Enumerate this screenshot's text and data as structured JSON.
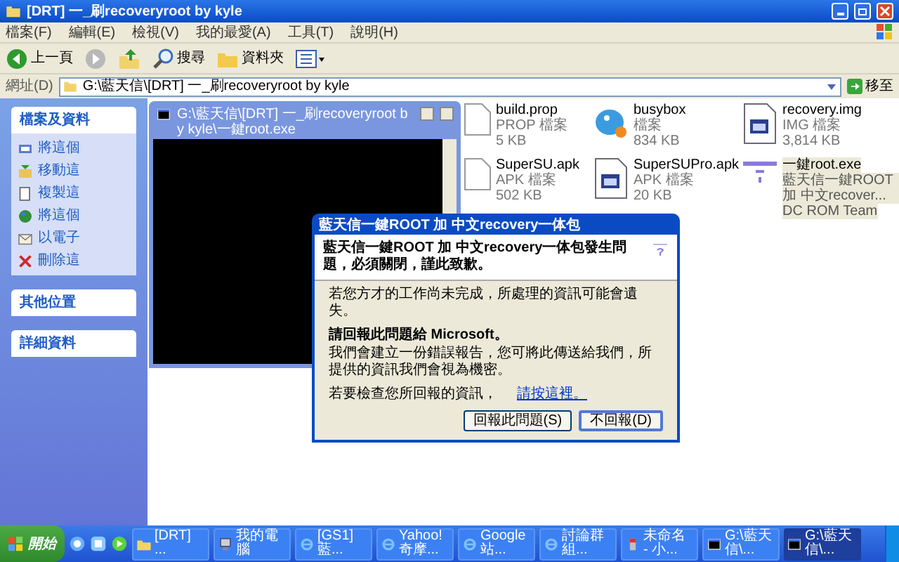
{
  "window": {
    "title": "[DRT] 一_刷recoveryroot by kyle"
  },
  "menu": [
    "檔案(F)",
    "編輯(E)",
    "檢視(V)",
    "我的最愛(A)",
    "工具(T)",
    "說明(H)"
  ],
  "toolbar": [
    {
      "kind": "back",
      "label": "上一頁"
    },
    {
      "kind": "forward"
    },
    {
      "kind": "up"
    },
    {
      "kind": "search",
      "label": "搜尋"
    },
    {
      "kind": "folders",
      "label": "資料夾"
    },
    {
      "kind": "views"
    }
  ],
  "address": {
    "label": "網址(D)",
    "value": "G:\\藍天信\\[DRT] 一_刷recoveryroot by kyle",
    "go": "移至"
  },
  "sidebar": {
    "sections": [
      {
        "title": "檔案及資料",
        "items": [
          "將這個",
          "移動這",
          "複製這",
          "將這個",
          "以電子",
          "刪除這"
        ]
      },
      {
        "title": "其他位置"
      },
      {
        "title": "詳細資料"
      }
    ]
  },
  "files": [
    {
      "kind": "doc",
      "name": "build.prop",
      "type": "PROP 檔案",
      "size": "5 KB",
      "selected": false
    },
    {
      "kind": "busybox",
      "name": "busybox",
      "type": "檔案",
      "size": "834 KB",
      "selected": false
    },
    {
      "kind": "app",
      "name": "recovery.img",
      "type": "IMG 檔案",
      "size": "3,814 KB",
      "selected": false
    },
    {
      "kind": "doc",
      "name": "SuperSU.apk",
      "type": "APK 檔案",
      "size": "502 KB",
      "selected": false
    },
    {
      "kind": "app",
      "name": "SuperSUPro.apk",
      "type": "APK 檔案",
      "size": "20 KB",
      "selected": false
    },
    {
      "kind": "exe",
      "name": "一鍵root.exe",
      "type": "藍天信一鍵ROOT 加 中文recover...",
      "size": "DC ROM Team",
      "selected": true
    }
  ],
  "console": {
    "title": "G:\\藍天信\\[DRT] 一_刷recoveryroot by kyle\\一鍵root.exe"
  },
  "dialog": {
    "title": "藍天信一鍵ROOT 加 中文recovery一体包",
    "heading": "藍天信一鍵ROOT 加 中文recovery一体包發生問題，必須關閉，謹此致歉。",
    "warning": "若您方才的工作尚未完成，所處理的資訊可能會遺失。",
    "report_title": "請回報此問題給 Microsoft。",
    "report_body": "我們會建立一份錯誤報告，您可將此傳送給我們，所提供的資訊我們會視為機密。",
    "details": "若要檢查您所回報的資訊，",
    "link": "請按這裡。",
    "buttons": [
      "回報此問題(S)",
      "不回報(D)"
    ]
  },
  "taskbar": {
    "start": "開始",
    "tasks": [
      {
        "kind": "folder",
        "label": "[DRT] ...",
        "selected": false
      },
      {
        "kind": "computer",
        "label": "我的電腦",
        "selected": false
      },
      {
        "kind": "browser",
        "label": "[GS1] 藍...",
        "selected": false
      },
      {
        "kind": "browser",
        "label": "Yahoo!奇摩...",
        "selected": false
      },
      {
        "kind": "browser",
        "label": "Google 站...",
        "selected": false
      },
      {
        "kind": "browser",
        "label": "討論群組...",
        "selected": false
      },
      {
        "kind": "paint",
        "label": "未命名 - 小...",
        "selected": false
      },
      {
        "kind": "console",
        "label": "G:\\藍天信\\...",
        "selected": false
      },
      {
        "kind": "console",
        "label": "G:\\藍天信\\...",
        "selected": true
      }
    ]
  }
}
